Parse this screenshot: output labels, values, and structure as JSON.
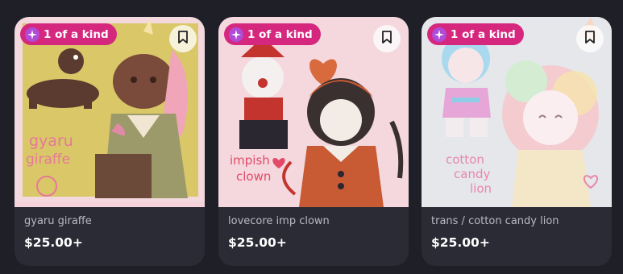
{
  "listings": [
    {
      "badge": "1 of a kind",
      "title": "gyaru giraffe",
      "price": "$25.00+",
      "art_text": [
        "gyaru",
        "giraffe"
      ]
    },
    {
      "badge": "1 of a kind",
      "title": "lovecore imp clown",
      "price": "$25.00+",
      "art_text": [
        "impish",
        "clown"
      ]
    },
    {
      "badge": "1 of a kind",
      "title": "trans / cotton candy lion",
      "price": "$25.00+",
      "art_text": [
        "cotton",
        "candy",
        "lion"
      ]
    }
  ],
  "colors": {
    "page_bg": "#1f1f27",
    "card_bg": "#2b2b35",
    "badge_bg": "#d6277f"
  },
  "icons": {
    "badge_icon": "sparkle-icon",
    "save_icon": "bookmark-icon"
  }
}
